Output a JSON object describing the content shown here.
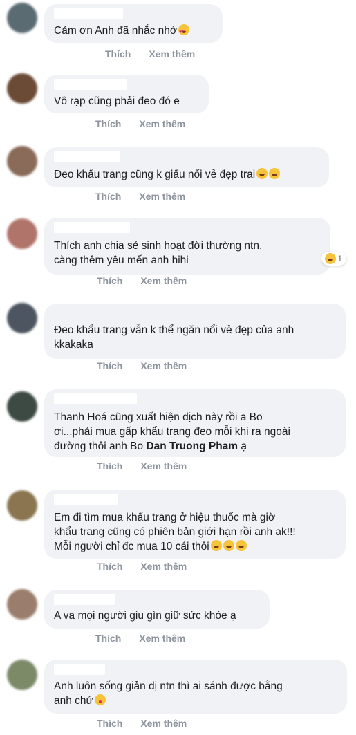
{
  "actions": {
    "like": "Thích",
    "more": "Xem thêm"
  },
  "comments": [
    {
      "text": "Cảm ơn Anh đã nhắc nhở",
      "emoji": "heart-eyes-emoji"
    },
    {
      "text": "Vô rạp cũng phải đeo đó e"
    },
    {
      "text": "Đeo khẩu trang cũng k giấu nổi vẻ đẹp trai",
      "emoji": "laughing-emoji"
    },
    {
      "text": "Thích anh chia sẻ sinh hoạt đời thường ntn,\ncàng thêm yêu mến anh hihi",
      "reaction_count": "1"
    },
    {
      "text": "Đeo khẩu trang vẫn k thể ngăn nổi vẻ đẹp của anh\nkkakaka"
    },
    {
      "text": "Thanh Hoá cũng xuất hiện dịch này rồi a Bo\nơi...phải mua gấp khẩu trang đeo mỗi khi ra ngoài\nđường thôi anh Bo ",
      "mention": "Dan Truong Pham",
      "suffix": " ạ"
    },
    {
      "text": "Em đi tìm mua khẩu trang ở hiệu thuốc mà giờ\nkhẩu trang cũng có phiên bản giới hạn rồi anh ak!!!\nMỗi người chỉ đc mua 10 cái thôi",
      "emoji": "laughing-emoji"
    },
    {
      "text": "A va mọi người giu gìn giữ sức khỏe ạ"
    },
    {
      "text": "Anh luôn sống giản dị ntn thì ai sánh được bằng\nanh chứ",
      "emoji": "kiss-emoji"
    }
  ],
  "colors": {
    "bubble": "#f0f2f5",
    "action_text": "#8d949e",
    "text": "#1c1e21"
  }
}
